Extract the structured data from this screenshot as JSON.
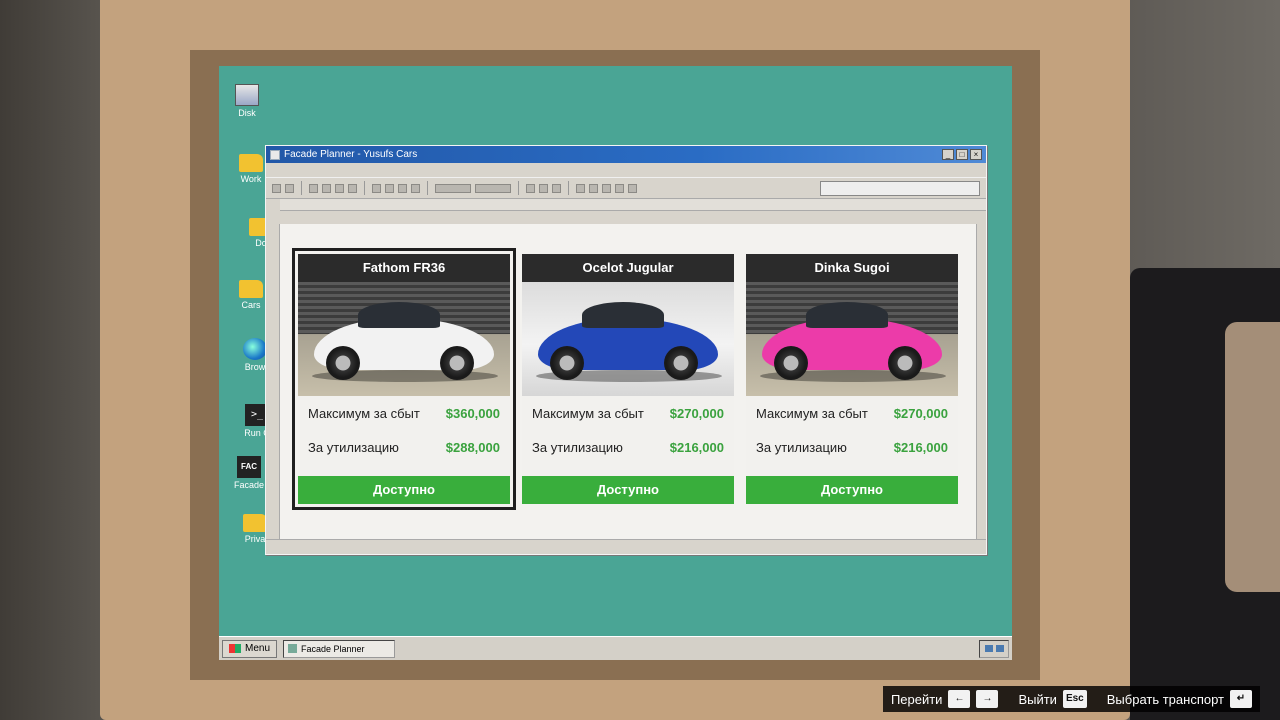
{
  "window": {
    "title": "Facade Planner - Yusufs Cars"
  },
  "desktop_icons": [
    {
      "label": "Disk",
      "icon": "disk-icon"
    },
    {
      "label": "Work",
      "icon": "folder-icon"
    },
    {
      "label": "Do",
      "icon": "folder-icon"
    },
    {
      "label": "Cars",
      "icon": "folder-icon"
    },
    {
      "label": "Brow",
      "icon": "globe-icon"
    },
    {
      "label": "Run C",
      "icon": "terminal-icon"
    },
    {
      "label": "Facade",
      "icon": "facade-icon"
    },
    {
      "label": "Priva",
      "icon": "folder-icon"
    }
  ],
  "cards": [
    {
      "name": "Fathom FR36",
      "max_label": "Максимум за сбыт",
      "max_value": "$360,000",
      "scrap_label": "За утилизацию",
      "scrap_value": "$288,000",
      "status": "Доступно",
      "color": "#f2f2f2",
      "selected": true
    },
    {
      "name": "Ocelot Jugular",
      "max_label": "Максимум за сбыт",
      "max_value": "$270,000",
      "scrap_label": "За утилизацию",
      "scrap_value": "$216,000",
      "status": "Доступно",
      "color": "#2348b8",
      "selected": false
    },
    {
      "name": "Dinka Sugoi",
      "max_label": "Максимум за сбыт",
      "max_value": "$270,000",
      "scrap_label": "За утилизацию",
      "scrap_value": "$216,000",
      "status": "Доступно",
      "color": "#ec3ba9",
      "selected": false
    }
  ],
  "taskbar": {
    "start_label": "Menu",
    "task_label": "Facade Planner"
  },
  "prompts": {
    "navigate": "Перейти",
    "exit": "Выйти",
    "exit_key": "Esc",
    "select": "Выбрать транспорт"
  },
  "colors": {
    "accent_green": "#39ae3c",
    "price_green": "#3aa23e",
    "desktop": "#4aa595",
    "titlebar": "#2258a8"
  }
}
